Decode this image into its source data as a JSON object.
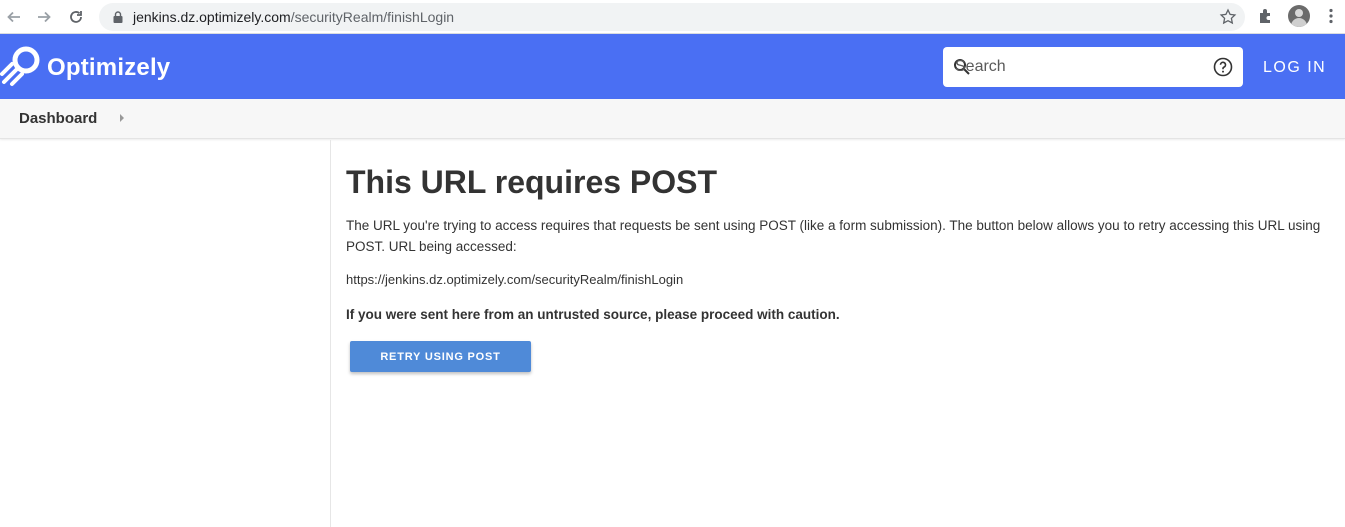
{
  "browser": {
    "url_host": "jenkins.dz.optimizely.com",
    "url_path": "/securityRealm/finishLogin"
  },
  "header": {
    "brand": "Optimizely",
    "search_placeholder": "Search",
    "login_label": "LOG IN",
    "accent_color": "#4a6ff3"
  },
  "breadcrumb": {
    "items": [
      "Dashboard"
    ]
  },
  "main": {
    "title": "This URL requires POST",
    "description": "The URL you're trying to access requires that requests be sent using POST (like a form submission). The button below allows you to retry accessing this URL using POST. URL being accessed:",
    "url": "https://jenkins.dz.optimizely.com/securityRealm/finishLogin",
    "warning": "If you were sent here from an untrusted source, please proceed with caution.",
    "retry_button": "RETRY USING POST"
  },
  "icons": [
    "back-icon",
    "forward-icon",
    "reload-icon",
    "lock-icon",
    "star-icon",
    "extensions-icon",
    "avatar",
    "menu-icon",
    "optimizely-logo",
    "search-icon",
    "help-icon"
  ]
}
